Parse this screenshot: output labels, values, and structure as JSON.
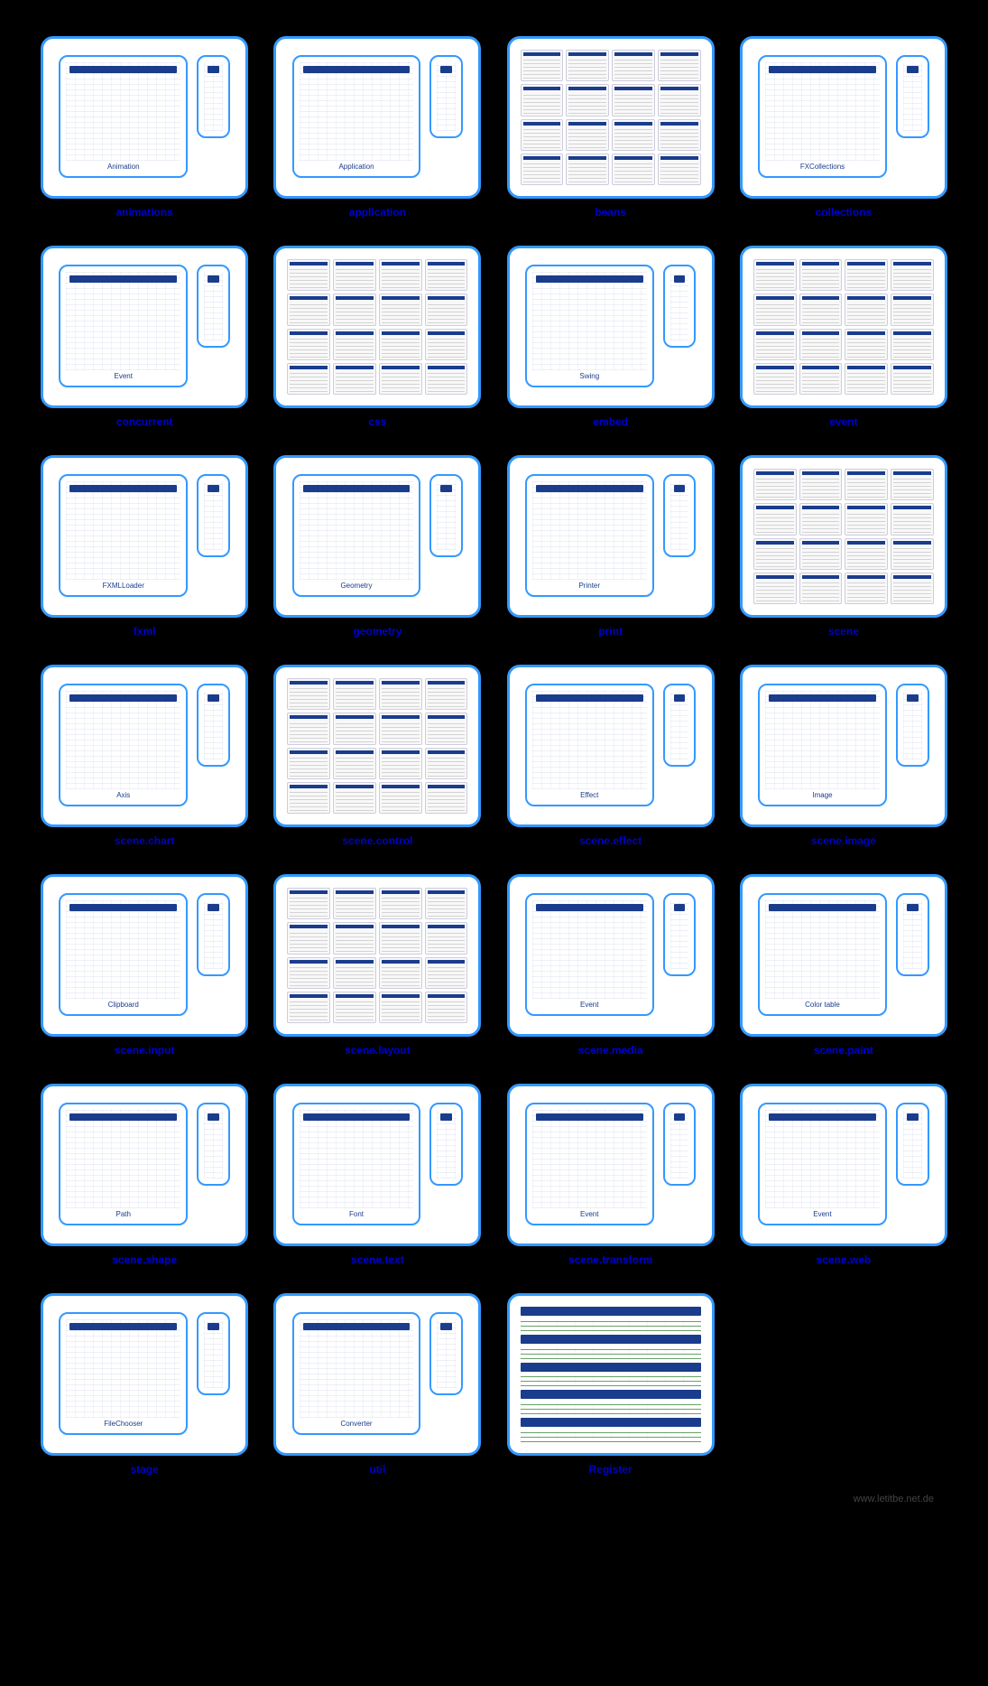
{
  "footer": "www.letitbe.net.de",
  "items": [
    {
      "title": "animations",
      "caption": "Animation",
      "layout": "dual"
    },
    {
      "title": "application",
      "caption": "Application",
      "layout": "dual"
    },
    {
      "title": "beans",
      "caption": "",
      "layout": "full"
    },
    {
      "title": "collections",
      "caption": "FXCollections",
      "layout": "dual"
    },
    {
      "title": "concurrent",
      "caption": "Event",
      "layout": "dual"
    },
    {
      "title": "css",
      "caption": "",
      "layout": "full"
    },
    {
      "title": "embed",
      "caption": "Swing",
      "layout": "dual"
    },
    {
      "title": "event",
      "caption": "",
      "layout": "full"
    },
    {
      "title": "fxml",
      "caption": "FXMLLoader",
      "layout": "dual"
    },
    {
      "title": "geometry",
      "caption": "Geometry",
      "layout": "dual"
    },
    {
      "title": "print",
      "caption": "Printer",
      "layout": "dual"
    },
    {
      "title": "scene",
      "caption": "",
      "layout": "full"
    },
    {
      "title": "scene.chart",
      "caption": "Axis",
      "layout": "dual"
    },
    {
      "title": "scene.control",
      "caption": "",
      "layout": "full"
    },
    {
      "title": "scene.effect",
      "caption": "Effect",
      "layout": "dual"
    },
    {
      "title": "scene.image",
      "caption": "Image",
      "layout": "dual"
    },
    {
      "title": "scene.input",
      "caption": "Clipboard",
      "layout": "dual"
    },
    {
      "title": "scene.layout",
      "caption": "",
      "layout": "full"
    },
    {
      "title": "scene.media",
      "caption": "Event",
      "layout": "dual"
    },
    {
      "title": "scene.paint",
      "caption": "Color table",
      "layout": "dual"
    },
    {
      "title": "scene.shape",
      "caption": "Path",
      "layout": "dual"
    },
    {
      "title": "scene.text",
      "caption": "Font",
      "layout": "dual"
    },
    {
      "title": "scene.transform",
      "caption": "Event",
      "layout": "dual"
    },
    {
      "title": "scene.web",
      "caption": "Event",
      "layout": "dual"
    },
    {
      "title": "stage",
      "caption": "FileChooser",
      "layout": "dual"
    },
    {
      "title": "util",
      "caption": "Converter",
      "layout": "dual"
    },
    {
      "title": "Register",
      "caption": "",
      "layout": "register"
    }
  ]
}
